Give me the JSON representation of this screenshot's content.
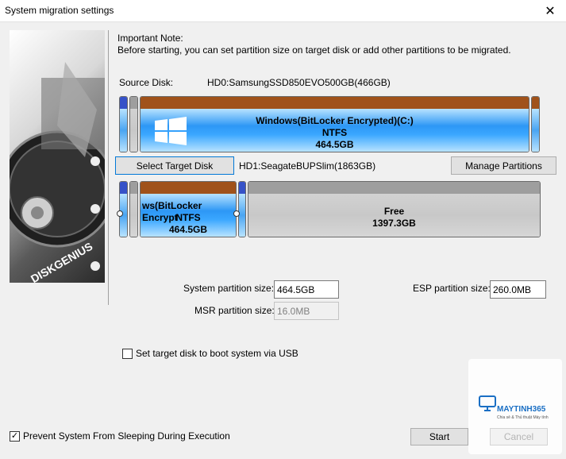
{
  "window": {
    "title": "System migration settings",
    "close_glyph": "✕"
  },
  "sidebar_image": {
    "brand_text": "DISKGENIUS"
  },
  "note": {
    "heading": "Important Note:",
    "body": "Before starting, you can set partition size on target disk or add other partitions to be migrated."
  },
  "source": {
    "label": "Source Disk:",
    "disk_name": "HD0:SamsungSSD850EVO500GB(466GB)",
    "main_partition": {
      "name": "Windows(BitLocker Encrypted)(C:)",
      "fs": "NTFS",
      "size": "464.5GB",
      "icon": "windows-logo-icon"
    }
  },
  "target": {
    "select_button": "Select Target Disk",
    "disk_name": "HD1:SeagateBUPSlim(1863GB)",
    "manage_button": "Manage Partitions",
    "main_partition": {
      "name": "ws(BitLocker Encrypt",
      "fs": "NTFS",
      "size": "464.5GB"
    },
    "free_partition": {
      "name": "Free",
      "size": "1397.3GB"
    }
  },
  "sizes": {
    "system_label": "System partition size:",
    "system_value": "464.5GB",
    "esp_label": "ESP partition size:",
    "esp_value": "260.0MB",
    "msr_label": "MSR partition size:",
    "msr_value": "16.0MB"
  },
  "options": {
    "usb_boot_label": "Set target disk to boot system via USB",
    "usb_boot_checked": false,
    "prevent_sleep_label": "Prevent System From Sleeping During Execution",
    "prevent_sleep_checked": true,
    "check_glyph": "✓"
  },
  "actions": {
    "start": "Start",
    "cancel": "Cancel"
  },
  "watermark": {
    "brand": "MAYTINH365",
    "tagline": "Chia sẻ & Thủ thuật Máy tính"
  }
}
